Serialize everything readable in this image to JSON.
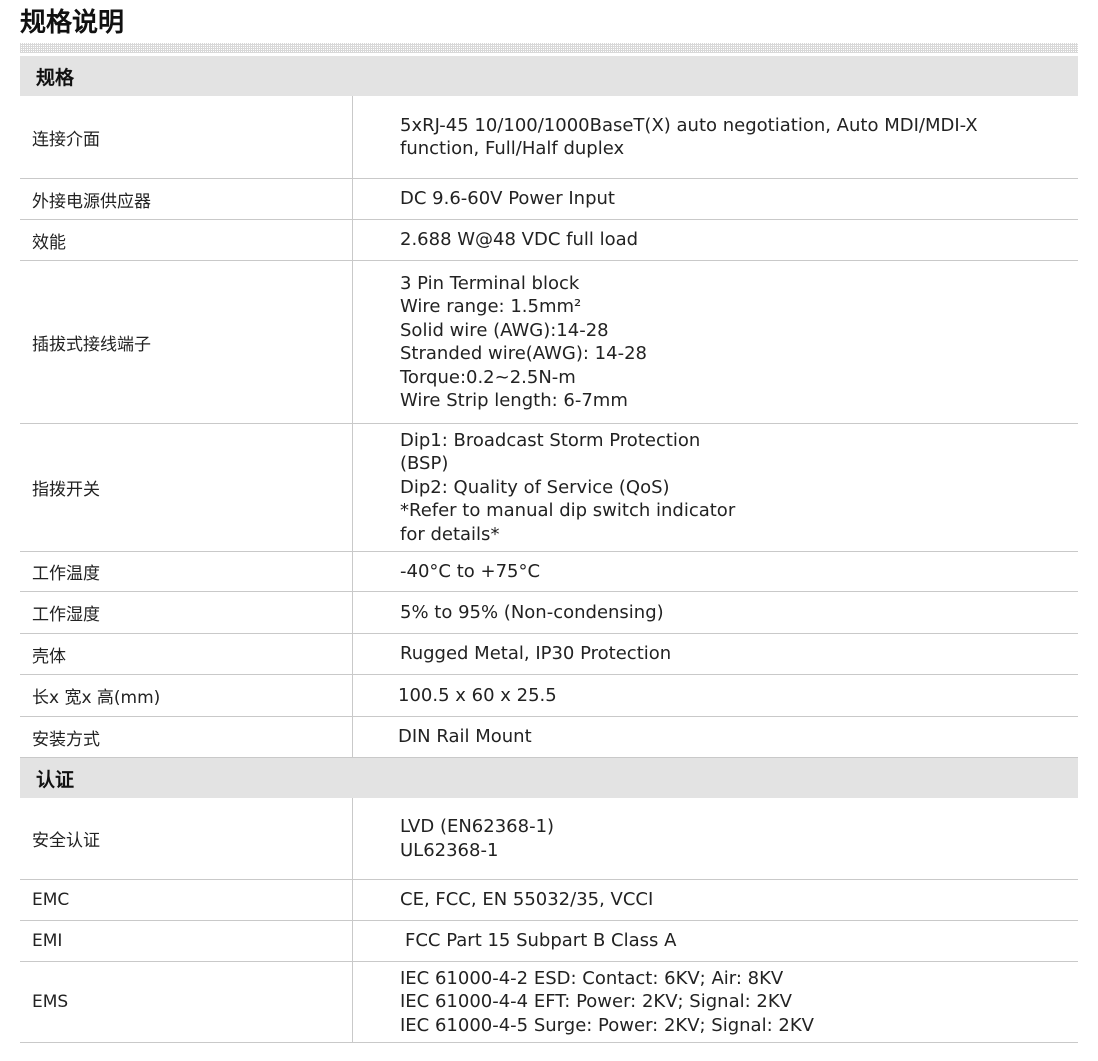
{
  "title": "规格说明",
  "sections": [
    {
      "header": "规格",
      "rows": [
        {
          "label": "连接介面",
          "height": 83,
          "lines": [
            "5xRJ-45 10/100/1000BaseT(X) auto negotiation, Auto MDI/MDI-X",
            "function, Full/Half duplex"
          ]
        },
        {
          "label": "外接电源供应器",
          "height": 41,
          "lines": [
            "DC 9.6-60V Power Input"
          ]
        },
        {
          "label": "效能",
          "height": 41,
          "lines": [
            "2.688 W@48 VDC full load"
          ]
        },
        {
          "label": "插拔式接线端子",
          "height": 163,
          "lines": [
            "3 Pin Terminal block",
            "Wire range: 1.5mm²",
            "Solid wire (AWG):14-28",
            "Stranded wire(AWG): 14-28",
            "Torque:0.2~2.5N-m",
            "Wire Strip length: 6-7mm"
          ]
        },
        {
          "label": "指拨开关",
          "height": 128,
          "lines": [
            "Dip1: Broadcast Storm Protection",
            "(BSP)",
            "Dip2: Quality of Service (QoS)",
            "*Refer to manual dip switch indicator",
            "for details*"
          ]
        },
        {
          "label": "工作温度",
          "height": 40,
          "lines": [
            "-40°C to +75°C"
          ]
        },
        {
          "label": "工作湿度",
          "height": 42,
          "lines": [
            "5% to 95% (Non-condensing)"
          ]
        },
        {
          "label": "壳体",
          "height": 41,
          "lines": [
            "Rugged Metal, IP30 Protection"
          ]
        },
        {
          "label": "长x 宽x 高(mm)",
          "height": 42,
          "lines": [
            "100.5 x 60 x 25.5"
          ],
          "shift": "l"
        },
        {
          "label": "安装方式",
          "height": 41,
          "lines": [
            "DIN Rail Mount"
          ],
          "shift": "l"
        }
      ]
    },
    {
      "header": "认证",
      "rows": [
        {
          "label": "安全认证",
          "height": 82,
          "lines": [
            "LVD (EN62368-1)",
            "UL62368-1"
          ]
        },
        {
          "label": "EMC",
          "height": 41,
          "lines": [
            "CE, FCC, EN 55032/35, VCCI"
          ]
        },
        {
          "label": "EMI",
          "height": 41,
          "lines": [
            "FCC Part 15 Subpart B Class A"
          ],
          "shift": "r"
        },
        {
          "label": "EMS",
          "height": 81,
          "lines": [
            "IEC 61000-4-2 ESD: Contact: 6KV; Air: 8KV",
            "IEC 61000-4-4 EFT: Power: 2KV; Signal: 2KV",
            "IEC 61000-4-5 Surge: Power: 2KV; Signal: 2KV"
          ]
        }
      ]
    }
  ]
}
